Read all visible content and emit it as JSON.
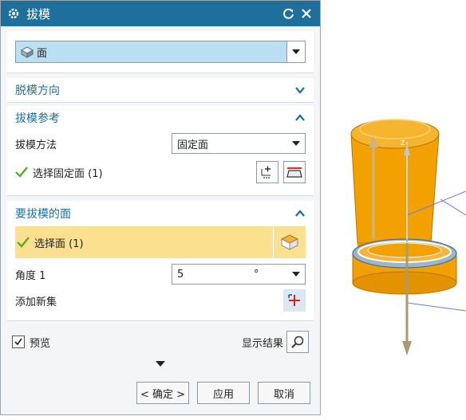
{
  "dialog": {
    "title": "拔模",
    "type_select": {
      "value": "面"
    },
    "sections": {
      "draw_direction": {
        "title": "脱模方向"
      },
      "draft_reference": {
        "title": "拔模参考",
        "method_label": "拔模方法",
        "method_value": "固定面",
        "select_label": "选择固定面 (1)"
      },
      "faces_to_draft": {
        "title": "要拔模的面",
        "select_label": "选择面 (1)",
        "angle_label": "角度 1",
        "angle_value": "5",
        "angle_unit": "°",
        "add_set_label": "添加新集"
      }
    },
    "preview_label": "预览",
    "show_result_label": "显示结果",
    "buttons": {
      "ok": "< 确定 >",
      "apply": "应用",
      "cancel": "取消"
    }
  },
  "colors": {
    "titlebar": "#1f6f9c",
    "section_header_text": "#1f6f9c",
    "selected_row": "#fbe08f",
    "type_select_bg": "#b9dff0",
    "part_orange": "#f2a100",
    "check_green": "#4caf1a"
  }
}
